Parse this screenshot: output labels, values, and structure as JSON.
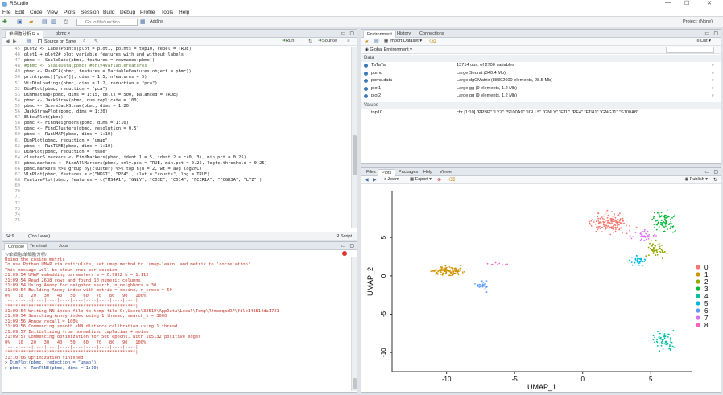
{
  "app": {
    "title": "RStudio",
    "project": "Project: (None)"
  },
  "menu": [
    "File",
    "Edit",
    "Code",
    "View",
    "Plots",
    "Session",
    "Build",
    "Debug",
    "Profile",
    "Tools",
    "Help"
  ],
  "toolbar": {
    "goto": "Go to file/function",
    "addins": "Addins"
  },
  "editor": {
    "tabs": [
      "单细胞分析.R",
      "pbmc"
    ],
    "source_on_save": "Source on Save",
    "run": "Run",
    "source": "Source",
    "status_pos": "64:9",
    "status_level": "(Top Level)",
    "status_type": "R Script",
    "lines": [
      {
        "n": "45",
        "t": "plot2 <- LabelPoints(plot = plot1, points = top10, repel = TRUE)"
      },
      {
        "n": "46",
        "t": "plot1 + plot2# plot variable features with and without labels"
      },
      {
        "n": "47",
        "t": ""
      },
      {
        "n": "48",
        "t": "pbmc <- ScaleData(pbmc, features = rownames(pbmc))"
      },
      {
        "n": "49",
        "t": "#pbmc <- ScaleData(pbmc) #only4VariableFeatures"
      },
      {
        "n": "50",
        "t": ""
      },
      {
        "n": "51",
        "t": "pbmc <- RunPCA(pbmc, features = VariableFeatures(object = pbmc))"
      },
      {
        "n": "52",
        "t": "print(pbmc[[\"pca\"]], dims = 1:5, nfeatures = 5)"
      },
      {
        "n": "53",
        "t": "VizDimLoadings(pbmc, dims = 1:2, reduction = \"pca\")"
      },
      {
        "n": "54",
        "t": "DimPlot(pbmc, reduction = \"pca\")"
      },
      {
        "n": "55",
        "t": ""
      },
      {
        "n": "56",
        "t": "DimHeatmap(pbmc, dims = 1:15, cells = 500, balanced = TRUE)"
      },
      {
        "n": "57",
        "t": ""
      },
      {
        "n": "58",
        "t": "pbmc <- JackStraw(pbmc, num.replicate = 100)"
      },
      {
        "n": "59",
        "t": "pbmc <- ScoreJackStraw(pbmc, dims = 1:20)"
      },
      {
        "n": "60",
        "t": "JackStrawPlot(pbmc, dims = 1:20)"
      },
      {
        "n": "61",
        "t": "ElbowPlot(pbmc)"
      },
      {
        "n": "62",
        "t": ""
      },
      {
        "n": "63",
        "t": "pbmc <- FindNeighbors(pbmc, dims = 1:10)"
      },
      {
        "n": "64",
        "t": "pbmc <- FindClusters(pbmc, resolution = 0.5)"
      },
      {
        "n": "65",
        "t": "pbmc <- RunUMAP(pbmc, dims = 1:10)"
      },
      {
        "n": "66",
        "t": "DimPlot(pbmc, reduction = \"umap\")"
      },
      {
        "n": "67",
        "t": ""
      },
      {
        "n": "68",
        "t": "pbmc <- RunTSNE(pbmc, dims = 1:10)"
      },
      {
        "n": "69",
        "t": "DimPlot(pbmc, reduction = \"tsne\")"
      },
      {
        "n": "70",
        "t": ""
      },
      {
        "n": "71",
        "t": "cluster5.markers <- FindMarkers(pbmc, ident.1 = 5, ident.2 = c(0, 3), min.pct = 0.25)"
      },
      {
        "n": "72",
        "t": "pbmc.markers <- FindAllMarkers(pbmc, only.pos = TRUE, min.pct = 0.25, logfc.threshold = 0.25)"
      },
      {
        "n": "73",
        "t": "pbmc.markers %>% group_by(cluster) %>% top_n(n = 2, wt = avg_log2FC)"
      },
      {
        "n": "74",
        "t": "VlnPlot(pbmc, features = c(\"NKG7\", \"PF4\"), slot = \"counts\", log = TRUE)"
      },
      {
        "n": "75",
        "t": "FeaturePlot(pbmc, features = c(\"MS4A1\", \"GNLY\", \"CD3E\", \"CD14\", \"FCER1A\", \"FCGR3A\", \"LYZ\"))"
      }
    ]
  },
  "console": {
    "tabs": [
      "Console",
      "Terminal",
      "Jobs"
    ],
    "path": "~/单细胞/单细胞分析/",
    "lines": [
      {
        "t": "Using the cosine metric",
        "c": "out"
      },
      {
        "t": "To use Python UMAP via reticulate, set umap.method to 'umap-learn' and metric to 'correlation'",
        "c": "out"
      },
      {
        "t": "This message will be shown once per session",
        "c": "out"
      },
      {
        "t": "21:09:54 UMAP embedding parameters a = 0.9922 b = 1.112",
        "c": "out"
      },
      {
        "t": "21:09:54 Read 2638 rows and found 10 numeric columns",
        "c": "out"
      },
      {
        "t": "21:09:54 Using Annoy for neighbor search, n_neighbors = 30",
        "c": "out"
      },
      {
        "t": "21:09:54 Building Annoy index with metric = cosine, n_trees = 50",
        "c": "out"
      },
      {
        "t": "0%   10   20   30   40   50   60   70   80   90   100%",
        "c": "out"
      },
      {
        "t": "[----|----|----|----|----|----|----|----|----|----|",
        "c": "out"
      },
      {
        "t": "**************************************************|",
        "c": "out"
      },
      {
        "t": "21:09:54 Writing NN index file to temp file C:\\Users\\32519\\AppData\\Local\\Temp\\RtmpmqmcDP\\file148814da1721",
        "c": "out"
      },
      {
        "t": "21:09:54 Searching Annoy index using 1 thread, search_k = 3000",
        "c": "out"
      },
      {
        "t": "21:09:56 Annoy recall = 100%",
        "c": "out"
      },
      {
        "t": "21:09:56 Commencing smooth kNN distance calibration using 1 thread",
        "c": "out"
      },
      {
        "t": "21:09:57 Initializing from normalized Laplacian + noise",
        "c": "out"
      },
      {
        "t": "21:09:57 Commencing optimization for 500 epochs, with 105132 positive edges",
        "c": "out"
      },
      {
        "t": "0%   10   20   30   40   50   60   70   80   90   100%",
        "c": "out"
      },
      {
        "t": "[----|----|----|----|----|----|----|----|----|----|",
        "c": "out"
      },
      {
        "t": "**************************************************|",
        "c": "out"
      },
      {
        "t": "21:10:06 Optimization finished",
        "c": "out"
      },
      {
        "t": "> DimPlot(pbmc, reduction = \"umap\")",
        "c": "cmd"
      },
      {
        "t": "> pbmc <- RunTSNE(pbmc, dims = 1:10)",
        "c": "cmd"
      }
    ]
  },
  "environment": {
    "tabs": [
      "Environment",
      "History",
      "Connections"
    ],
    "import": "Import Dataset",
    "scope": "Global Environment",
    "list": "List",
    "data_header": "Data",
    "values_header": "Values",
    "data": [
      {
        "name": "TaTaTa",
        "value": "13714 obs. of 2700 variables"
      },
      {
        "name": "pbmc",
        "value": "Large Seurat (340.4 Mb)"
      },
      {
        "name": "pbmc.data",
        "value": "Large dgCMatrix (88392600 elements, 28.5 Mb)"
      },
      {
        "name": "plot1",
        "value": "Large gg (9 elements, 1.2 Mb)"
      },
      {
        "name": "plot2",
        "value": "Large gg (9 elements, 1.2 Mb)"
      }
    ],
    "values": [
      {
        "name": "top10",
        "value": "chr [1:10] \"PPBP\" \"LYZ\" \"S100A9\" \"IGLL5\" \"GNLY\" \"FTL\" \"PF4\" \"FTH1\" \"GNG11\" \"S100A8\""
      }
    ]
  },
  "files": {
    "tabs": [
      "Files",
      "Plots",
      "Packages",
      "Help",
      "Viewer"
    ],
    "zoom": "Zoom",
    "export": "Export",
    "publish": "Publish"
  },
  "chart_data": {
    "type": "scatter",
    "xlabel": "UMAP_1",
    "ylabel": "UMAP_2",
    "xticks": [
      -10,
      -5,
      0,
      5
    ],
    "yticks": [
      -10,
      -5,
      0,
      5
    ],
    "xlim": [
      -14,
      8
    ],
    "ylim": [
      -12.5,
      11
    ],
    "legend": {
      "placement": "right",
      "labels": [
        "0",
        "1",
        "2",
        "3",
        "4",
        "5",
        "6",
        "7",
        "8"
      ]
    },
    "colors": [
      "#F8766D",
      "#D39200",
      "#93AA00",
      "#00BA38",
      "#00C19F",
      "#00B9E3",
      "#619CFF",
      "#DB72FB",
      "#FF61C3"
    ],
    "clusters": [
      {
        "label": "0",
        "cx": 2.0,
        "cy": 6.9,
        "sx": 1.2,
        "sy": 1.0,
        "n": 150
      },
      {
        "label": "1",
        "cx": -10.0,
        "cy": 0.6,
        "sx": 1.1,
        "sy": 0.5,
        "n": 110
      },
      {
        "label": "2",
        "cx": 5.3,
        "cy": 3.5,
        "sx": 0.6,
        "sy": 0.8,
        "n": 50
      },
      {
        "label": "3",
        "cx": 6.0,
        "cy": 7.2,
        "sx": 0.7,
        "sy": 1.1,
        "n": 80
      },
      {
        "label": "4",
        "cx": 6.0,
        "cy": -8.5,
        "sx": 0.8,
        "sy": 0.9,
        "n": 60
      },
      {
        "label": "5",
        "cx": 4.1,
        "cy": 2.0,
        "sx": 0.5,
        "sy": 0.5,
        "n": 35
      },
      {
        "label": "6",
        "cx": -7.4,
        "cy": -1.2,
        "sx": 0.4,
        "sy": 0.5,
        "n": 30
      },
      {
        "label": "7",
        "cx": 4.6,
        "cy": 5.3,
        "sx": 0.7,
        "sy": 0.5,
        "n": 35
      },
      {
        "label": "8",
        "cx": -6.2,
        "cy": 1.5,
        "sx": 0.6,
        "sy": 0.2,
        "n": 10
      }
    ]
  }
}
